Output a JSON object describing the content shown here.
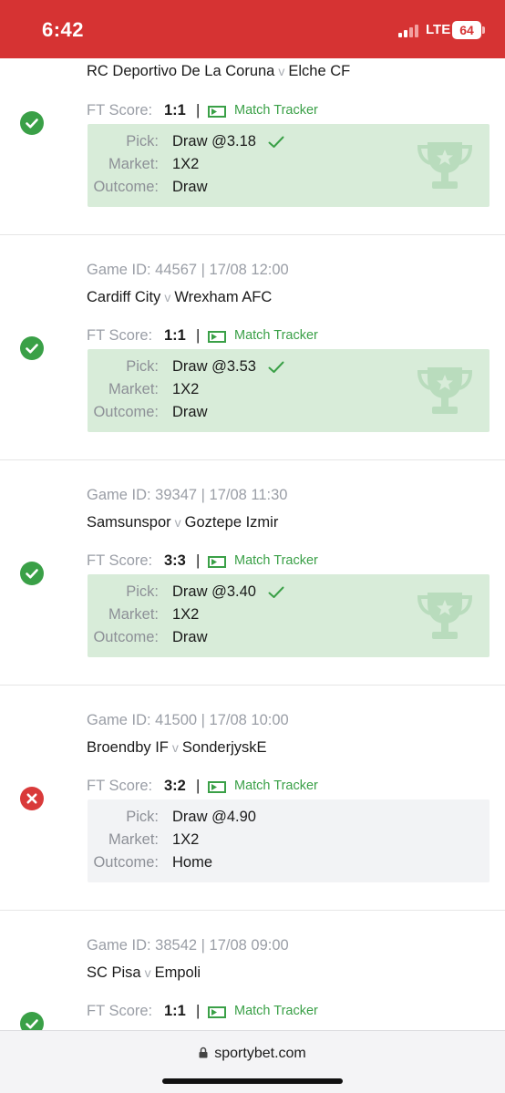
{
  "status_bar": {
    "time": "6:42",
    "network": "LTE",
    "battery": "64"
  },
  "labels": {
    "ft_score": "FT Score:",
    "match_tracker": "Match Tracker",
    "pick": "Pick:",
    "market": "Market:",
    "outcome": "Outcome:",
    "versus": "v",
    "separator": "|"
  },
  "bets": [
    {
      "status": "won",
      "game_id": "",
      "home": "RC Deportivo De La Coruna",
      "away": "Elche CF",
      "ft_score": "1:1",
      "pick": "Draw @3.18",
      "market": "1X2",
      "outcome": "Draw"
    },
    {
      "status": "won",
      "game_id": "Game ID: 44567 | 17/08 12:00",
      "home": "Cardiff City",
      "away": "Wrexham AFC",
      "ft_score": "1:1",
      "pick": "Draw @3.53",
      "market": "1X2",
      "outcome": "Draw"
    },
    {
      "status": "won",
      "game_id": "Game ID: 39347 | 17/08 11:30",
      "home": "Samsunspor",
      "away": "Goztepe Izmir",
      "ft_score": "3:3",
      "pick": "Draw @3.40",
      "market": "1X2",
      "outcome": "Draw"
    },
    {
      "status": "lost",
      "game_id": "Game ID: 41500 | 17/08 10:00",
      "home": "Broendby IF",
      "away": "SonderjyskE",
      "ft_score": "3:2",
      "pick": "Draw @4.90",
      "market": "1X2",
      "outcome": "Home"
    },
    {
      "status": "won",
      "game_id": "Game ID: 38542 | 17/08 09:00",
      "home": "SC Pisa",
      "away": "Empoli",
      "ft_score": "1:1"
    }
  ],
  "browser": {
    "url": "sportybet.com"
  },
  "colors": {
    "header": "#d63333",
    "win": "#3aa047",
    "lose": "#d93a3a",
    "win_box": "#d8ecd9",
    "lose_box": "#f2f3f5"
  }
}
